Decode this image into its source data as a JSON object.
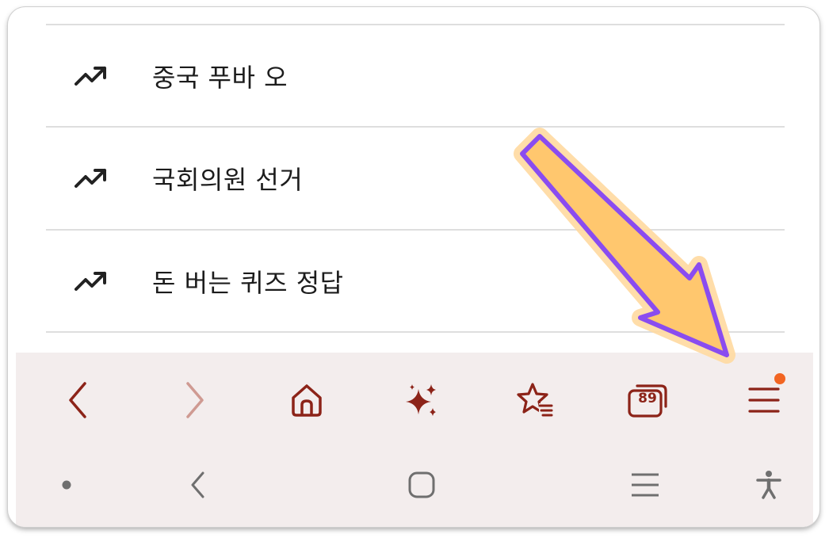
{
  "trending": {
    "items": [
      {
        "label": "중국 푸바 오",
        "icon": "trending-up-icon"
      },
      {
        "label": "국회의원 선거",
        "icon": "trending-up-icon"
      },
      {
        "label": "돈 버는 퀴즈 정답",
        "icon": "trending-up-icon"
      }
    ]
  },
  "browser_toolbar": {
    "buttons": [
      {
        "name": "back",
        "icon": "chevron-left-icon",
        "enabled": true
      },
      {
        "name": "forward",
        "icon": "chevron-right-icon",
        "enabled": false
      },
      {
        "name": "home",
        "icon": "home-icon"
      },
      {
        "name": "ai-assistant",
        "icon": "sparkles-icon"
      },
      {
        "name": "bookmarks",
        "icon": "star-list-icon"
      },
      {
        "name": "tabs",
        "icon": "tabs-icon",
        "count": "89"
      },
      {
        "name": "menu",
        "icon": "hamburger-icon",
        "has_notification": true
      }
    ]
  },
  "system_nav": {
    "buttons": [
      {
        "name": "recent-indicator",
        "icon": "dot-icon"
      },
      {
        "name": "back",
        "icon": "chevron-left-icon"
      },
      {
        "name": "home",
        "icon": "rounded-square-icon"
      },
      {
        "name": "recents",
        "icon": "three-lines-icon"
      },
      {
        "name": "accessibility",
        "icon": "accessibility-icon"
      }
    ]
  },
  "colors": {
    "toolbar_icon": "#8c2318",
    "toolbar_icon_disabled": "#cf9a92",
    "toolbar_bg": "#f3eded",
    "notification_dot": "#f26522",
    "system_icon": "#6f6f6f",
    "annotation_arrow_fill": "#ffc76e",
    "annotation_arrow_stroke": "#8a4cf0",
    "divider": "#dedede"
  }
}
